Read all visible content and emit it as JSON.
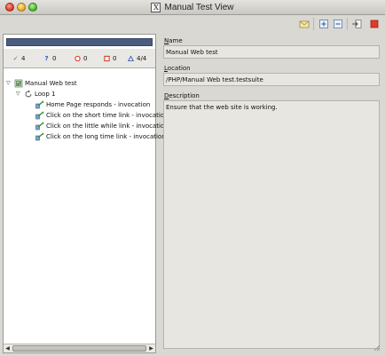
{
  "window": {
    "title": "Manual Test View",
    "x_icon_glyph": "X"
  },
  "toolbar": {
    "buttons": [
      {
        "name": "envelope-icon"
      },
      {
        "name": "expand-all-icon"
      },
      {
        "name": "collapse-all-icon"
      },
      {
        "name": "export-icon"
      },
      {
        "name": "stop-icon"
      }
    ]
  },
  "progress": {
    "fraction": 1.0,
    "color": "#4a5d80"
  },
  "stats": {
    "passed": "4",
    "unknown": "0",
    "failed": "0",
    "errors": "0",
    "completed": "4/4"
  },
  "tree": {
    "root": {
      "label": "Manual Web test",
      "expanded": true
    },
    "loop": {
      "label": "Loop 1",
      "expanded": true
    },
    "invocations": [
      "Home Page responds - invocation",
      "Click on the short time link - invocation",
      "Click on the little while link - invocation",
      "Click on the long time link - invocation"
    ]
  },
  "details": {
    "name_label_mnemonic": "N",
    "name_label_rest": "ame",
    "name_value": "Manual Web test",
    "location_label_mnemonic": "L",
    "location_label_rest": "ocation",
    "location_value": "/PHP/Manual Web test.testsuite",
    "description_label_mnemonic": "D",
    "description_label_rest": "escription",
    "description_value": "Ensure that the web site is working."
  }
}
